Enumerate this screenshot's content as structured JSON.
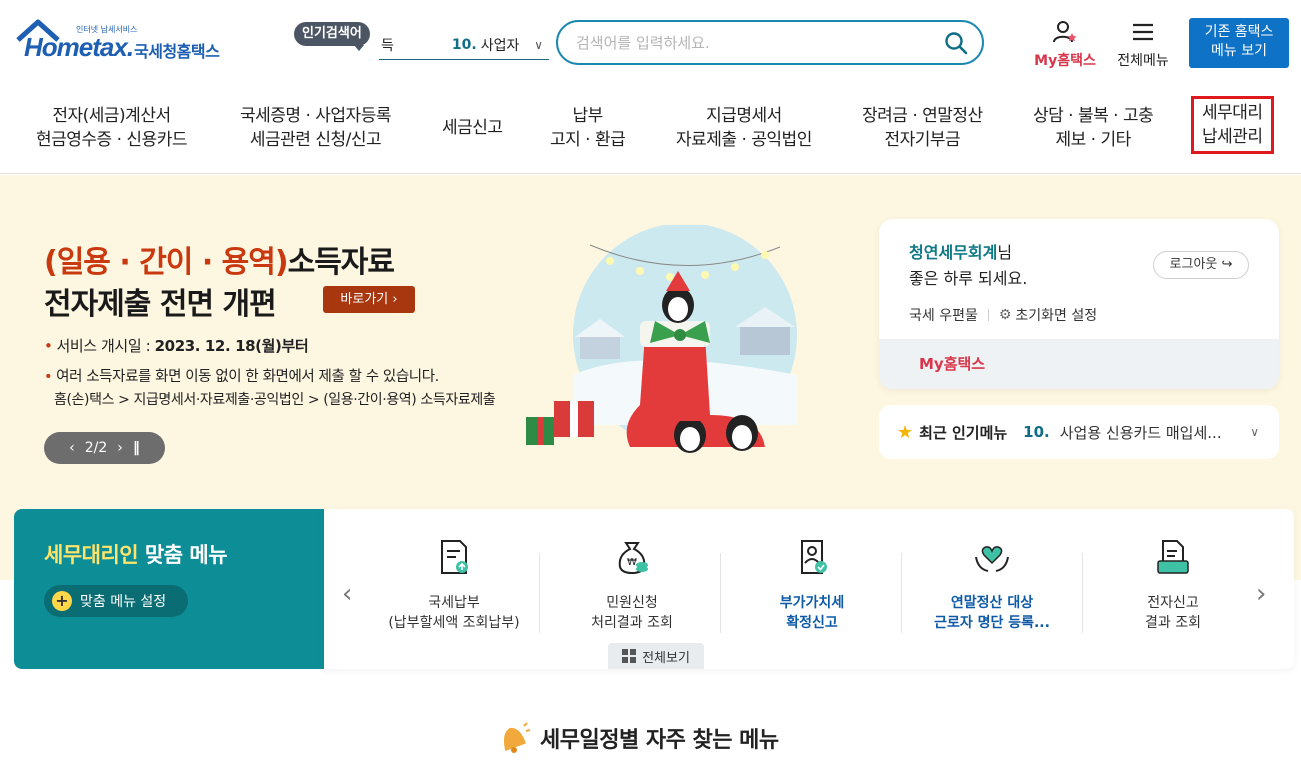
{
  "header": {
    "logo": {
      "brand": "Hometax.",
      "sub": "인터넷 납세서비스",
      "kr": "국세청홈택스"
    },
    "popular": {
      "badge": "인기검색어",
      "fragment": "득",
      "rank": "10.",
      "keyword": "사업자"
    },
    "search": {
      "placeholder": "검색어를 입력하세요."
    },
    "my_hometax": "My홈택스",
    "all_menu": "전체메뉴",
    "legacy": {
      "line1": "기존 홈택스",
      "line2": "메뉴 보기"
    }
  },
  "gnb": [
    {
      "l1": "전자(세금)계산서",
      "l2": "현금영수증 · 신용카드"
    },
    {
      "l1": "국세증명 · 사업자등록",
      "l2": "세금관련 신청/신고"
    },
    {
      "l1": "세금신고",
      "l2": ""
    },
    {
      "l1": "납부",
      "l2": "고지 · 환급"
    },
    {
      "l1": "지급명세서",
      "l2": "자료제출 · 공익법인"
    },
    {
      "l1": "장려금 · 연말정산",
      "l2": "전자기부금"
    },
    {
      "l1": "상담 · 불복 · 고충",
      "l2": "제보 · 기타"
    },
    {
      "l1": "세무대리",
      "l2": "납세관리"
    }
  ],
  "banner": {
    "title_accent": "(일용 · 간이 · 용역)",
    "title_rest": "소득자료",
    "title_line2": "전자제출 전면 개편",
    "go_label": "바로가기",
    "line1_label": "서비스 개시일 :",
    "line1_value": "2023. 12. 18(월)부터",
    "line2": "여러 소득자료를 화면 이동 없이 한 화면에서 제출 할 수 있습니다.",
    "line3": "홈(손)택스 > 지급명세서·자료제출·공익법인 > (일용·간이·용역) 소득자료제출",
    "page": "2/2"
  },
  "login": {
    "name": "청연세무회계",
    "suffix": "님",
    "greeting": "좋은 하루 되세요.",
    "logout": "로그아웃",
    "link1": "국세 우편물",
    "link2": "초기화면 설정",
    "my_hometax": "My홈택스"
  },
  "recent": {
    "title": "최근 인기메뉴",
    "rank": "10.",
    "value": "사업용 신용카드 매입세..."
  },
  "agent": {
    "title_accent": "세무대리인",
    "title_rest": " 맞춤 메뉴",
    "setting": "맞춤 메뉴 설정"
  },
  "quick": {
    "items": [
      {
        "l1": "국세납부",
        "l2": "(납부할세액 조회납부)",
        "icon": "document-upload-icon"
      },
      {
        "l1": "민원신청",
        "l2": "처리결과 조회",
        "icon": "money-bag-icon"
      },
      {
        "l1": "부가가치세",
        "l2": "확정신고",
        "icon": "vat-report-icon"
      },
      {
        "l1": "연말정산 대상",
        "l2": "근로자 명단 등록...",
        "icon": "heart-hands-icon"
      },
      {
        "l1": "전자신고",
        "l2": "결과 조회",
        "icon": "folder-result-icon"
      }
    ],
    "view_all": "전체보기"
  },
  "section": {
    "title": "세무일정별 자주 찾는 메뉴"
  },
  "colors": {
    "teal": "#0d8e97",
    "accent_red": "#c9380e",
    "highlight": "#e0191f",
    "blue": "#0e72c6"
  }
}
